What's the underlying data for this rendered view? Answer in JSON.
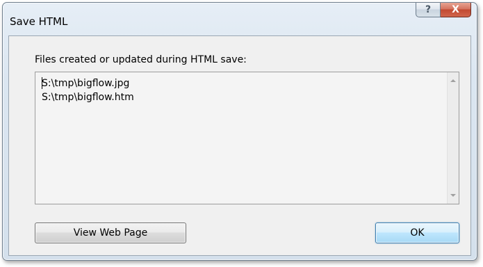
{
  "window": {
    "title": "Save HTML",
    "help_label": "?",
    "close_label": "X"
  },
  "dialog": {
    "files_label": "Files created or updated during HTML save:",
    "files": [
      "S:\\tmp\\bigflow.jpg",
      "S:\\tmp\\bigflow.htm"
    ]
  },
  "buttons": {
    "view_web_page": "View Web Page",
    "ok": "OK"
  },
  "colors": {
    "close_button": "#c24a32",
    "ok_border": "#3c7fb1",
    "dialog_background": "#f0f0f0"
  }
}
